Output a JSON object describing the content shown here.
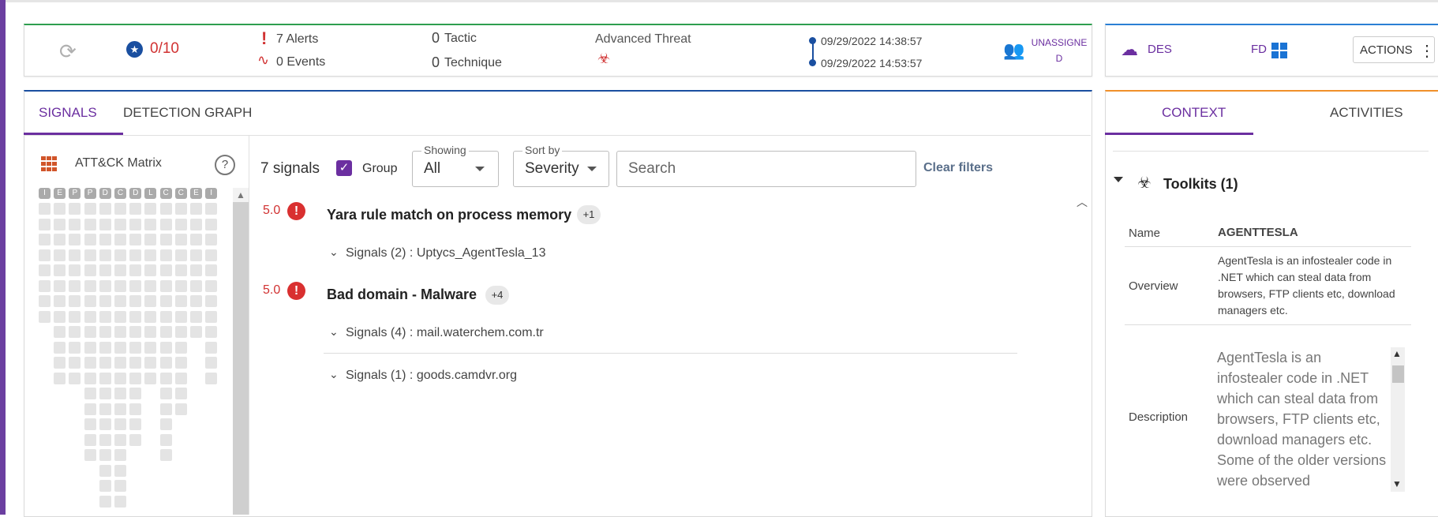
{
  "header": {
    "score": "0/10",
    "alerts_count": "7",
    "alerts_label": "Alerts",
    "events_count": "0",
    "events_label": "Events",
    "tactic_count": "0",
    "tactic_label": "Tactic",
    "technique_count": "0",
    "technique_label": "Technique",
    "threat_type": "Advanced Threat",
    "time_start": "09/29/2022 14:38:57",
    "time_end": "09/29/2022 14:53:57",
    "assignee": "UNASSIGNED",
    "des_text": "DES",
    "fd_text": "FD",
    "actions_label": "ACTIONS"
  },
  "colors": {
    "accent": "#6b2fa0",
    "alert": "#d13232",
    "brand_blue": "#1a4fa0"
  },
  "tabs": {
    "signals": "SIGNALS",
    "detection_graph": "DETECTION GRAPH"
  },
  "matrix": {
    "title": "ATT&CK Matrix",
    "help": "?",
    "columns": [
      "I",
      "E",
      "P",
      "P",
      "D",
      "C",
      "D",
      "L",
      "C",
      "C",
      "E",
      "I"
    ]
  },
  "signals": {
    "count_label": "7 signals",
    "group_label": "Group",
    "group_checked": true,
    "showing_label": "Showing",
    "showing_value": "All",
    "sortby_label": "Sort by",
    "sortby_value": "Severity",
    "search_placeholder": "Search",
    "clear_filters": "Clear filters",
    "items": [
      {
        "score": "5.0",
        "title": "Yara rule match on process memory",
        "badge": "+1",
        "groups": [
          "Signals (2) : Uptycs_AgentTesla_13"
        ]
      },
      {
        "score": "5.0",
        "title": "Bad domain - Malware",
        "badge": "+4",
        "groups": [
          "Signals (4) : mail.waterchem.com.tr",
          "Signals (1) : goods.camdvr.org"
        ]
      }
    ]
  },
  "context": {
    "tab_context": "CONTEXT",
    "tab_activities": "ACTIVITIES",
    "toolkits_title": "Toolkits (1)",
    "name_label": "Name",
    "name_value": "AGENTTESLA",
    "overview_label": "Overview",
    "overview_value": "AgentTesla is an infostealer code in .NET which can steal data from browsers, FTP clients etc, download managers etc.",
    "description_label": "Description",
    "description_value": "AgentTesla is an infostealer code in .NET which can steal data from browsers, FTP clients etc, download managers etc. Some of the older versions were observed"
  }
}
